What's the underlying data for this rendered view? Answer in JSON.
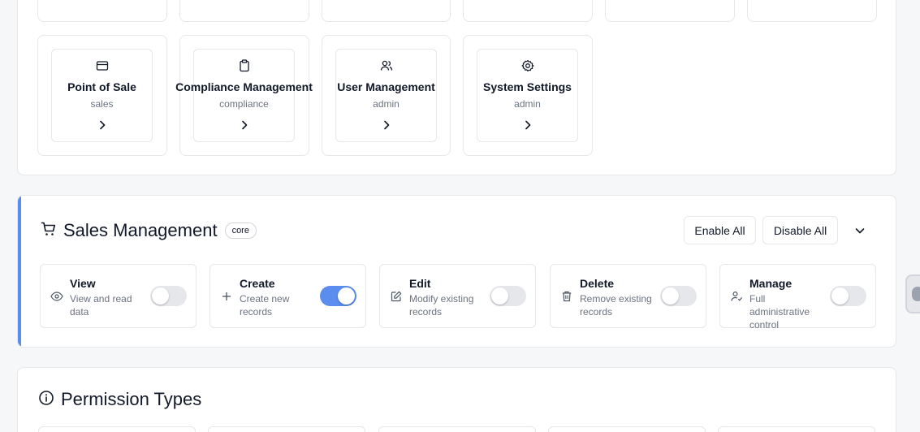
{
  "modules": [
    {
      "title": "Point of Sale",
      "category": "sales",
      "icon": "credit-card-icon"
    },
    {
      "title": "Compliance Management",
      "category": "compliance",
      "icon": "clipboard-icon"
    },
    {
      "title": "User Management",
      "category": "admin",
      "icon": "users-icon"
    },
    {
      "title": "System Settings",
      "category": "admin",
      "icon": "gear-icon"
    }
  ],
  "sales": {
    "title": "Sales Management",
    "badge": "core",
    "enable_all": "Enable All",
    "disable_all": "Disable All",
    "accent_color": "#5b8def",
    "permissions": [
      {
        "name": "View",
        "desc": "View and read data",
        "enabled": false,
        "icon": "eye-icon"
      },
      {
        "name": "Create",
        "desc": "Create new records",
        "enabled": true,
        "icon": "plus-icon"
      },
      {
        "name": "Edit",
        "desc": "Modify existing records",
        "enabled": false,
        "icon": "pencil-icon"
      },
      {
        "name": "Delete",
        "desc": "Remove existing records",
        "enabled": false,
        "icon": "trash-icon"
      },
      {
        "name": "Manage",
        "desc": "Full administrative control",
        "enabled": false,
        "icon": "user-cog-icon"
      }
    ]
  },
  "permission_types": {
    "title": "Permission Types"
  }
}
